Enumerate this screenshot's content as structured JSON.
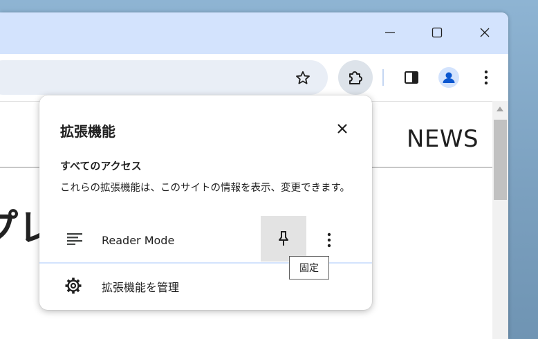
{
  "window": {
    "controls": {
      "minimize": "minimize-icon",
      "maximize": "maximize-icon",
      "close": "close-icon"
    }
  },
  "toolbar": {
    "bookmark_icon": "star-icon",
    "extensions_icon": "puzzle-icon",
    "sidepanel_icon": "side-panel-icon",
    "profile_icon": "profile-icon",
    "menu_icon": "vertical-dots-icon",
    "accent": "#1a5dd8"
  },
  "page": {
    "news_label": "NEWS",
    "big_char": "プレ"
  },
  "extensions_popup": {
    "title": "拡張機能",
    "section_heading": "すべてのアクセス",
    "section_description": "これらの拡張機能は、このサイトの情報を表示、変更できます。",
    "extensions": [
      {
        "name": "Reader Mode",
        "icon": "reader-mode-icon",
        "pin_icon": "pin-icon",
        "more_icon": "vertical-dots-icon"
      }
    ],
    "manage_label": "拡張機能を管理",
    "manage_icon": "gear-icon"
  },
  "tooltip": {
    "text": "固定"
  }
}
